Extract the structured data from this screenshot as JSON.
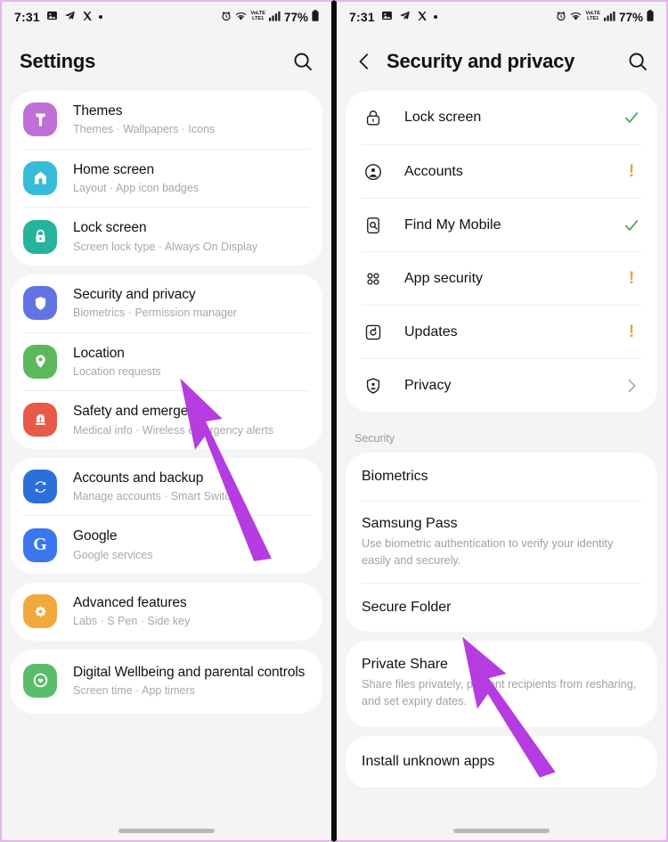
{
  "statusbar": {
    "time": "7:31",
    "battery": "77%",
    "network": "LTE1",
    "volte": "VoLTE",
    "icons": [
      "gallery-icon",
      "telegram-icon",
      "x-icon",
      "dot-icon",
      "alarm-icon",
      "wifi-icon",
      "volte-icon",
      "signal-icon",
      "battery-icon"
    ]
  },
  "left": {
    "header": {
      "title": "Settings",
      "search_icon": "search-icon"
    },
    "groups": [
      {
        "items": [
          {
            "title": "Themes",
            "subtitle": "Themes  ·  Wallpapers  ·  Icons",
            "icon": "themes-icon",
            "color": "#c06ed8"
          },
          {
            "title": "Home screen",
            "subtitle": "Layout  ·  App icon badges",
            "icon": "home-icon",
            "color": "#36bcd8"
          },
          {
            "title": "Lock screen",
            "subtitle": "Screen lock type  ·  Always On Display",
            "icon": "lock-icon",
            "color": "#25b39b"
          }
        ]
      },
      {
        "items": [
          {
            "title": "Security and privacy",
            "subtitle": "Biometrics  ·  Permission manager",
            "icon": "shield-icon",
            "color": "#6473e3"
          },
          {
            "title": "Location",
            "subtitle": "Location requests",
            "icon": "location-pin-icon",
            "color": "#5cb85c"
          },
          {
            "title": "Safety and emergency",
            "subtitle": "Medical info  ·  Wireless emergency alerts",
            "icon": "emergency-icon",
            "color": "#e8594a"
          }
        ]
      },
      {
        "items": [
          {
            "title": "Accounts and backup",
            "subtitle": "Manage accounts  ·  Smart Switch",
            "icon": "sync-icon",
            "color": "#2c6fdb"
          },
          {
            "title": "Google",
            "subtitle": "Google services",
            "icon": "google-g-icon",
            "color": "#3b76ef"
          }
        ]
      },
      {
        "items": [
          {
            "title": "Advanced features",
            "subtitle": "Labs  ·  S Pen  ·  Side key",
            "icon": "advanced-features-icon",
            "color": "#f2a93b"
          }
        ]
      },
      {
        "items": [
          {
            "title": "Digital Wellbeing and parental controls",
            "subtitle": "Screen time  ·  App timers",
            "icon": "wellbeing-icon",
            "color": "#5bbd6c"
          }
        ]
      }
    ]
  },
  "right": {
    "header": {
      "title": "Security and privacy",
      "back_icon": "back-chevron-icon",
      "search_icon": "search-icon"
    },
    "status_items": [
      {
        "label": "Lock screen",
        "icon": "padlock-outline-icon",
        "status": "check",
        "status_color": "#3aa34a"
      },
      {
        "label": "Accounts",
        "icon": "person-circle-icon",
        "status": "warning",
        "status_color": "#e8a33d"
      },
      {
        "label": "Find My Mobile",
        "icon": "find-device-icon",
        "status": "check",
        "status_color": "#3aa34a"
      },
      {
        "label": "App security",
        "icon": "apps-grid-icon",
        "status": "warning",
        "status_color": "#e8a33d"
      },
      {
        "label": "Updates",
        "icon": "update-square-icon",
        "status": "warning",
        "status_color": "#e8a33d"
      },
      {
        "label": "Privacy",
        "icon": "shield-person-icon",
        "status": "chevron",
        "status_color": "#9a9a9a"
      }
    ],
    "section_title": "Security",
    "security_groups": [
      {
        "items": [
          {
            "title": "Biometrics",
            "desc": ""
          },
          {
            "title": "Samsung Pass",
            "desc": "Use biometric authentication to verify your identity easily and securely."
          },
          {
            "title": "Secure Folder",
            "desc": ""
          }
        ]
      },
      {
        "items": [
          {
            "title": "Private Share",
            "desc": "Share files privately, prevent recipients from resharing, and set expiry dates."
          }
        ]
      },
      {
        "items": [
          {
            "title": "Install unknown apps",
            "desc": ""
          }
        ]
      }
    ]
  },
  "annotations": {
    "arrow_color": "#b43ce0",
    "arrows": [
      {
        "name": "arrow-to-security-and-privacy",
        "panel": "left"
      },
      {
        "name": "arrow-to-secure-folder",
        "panel": "right"
      }
    ]
  }
}
